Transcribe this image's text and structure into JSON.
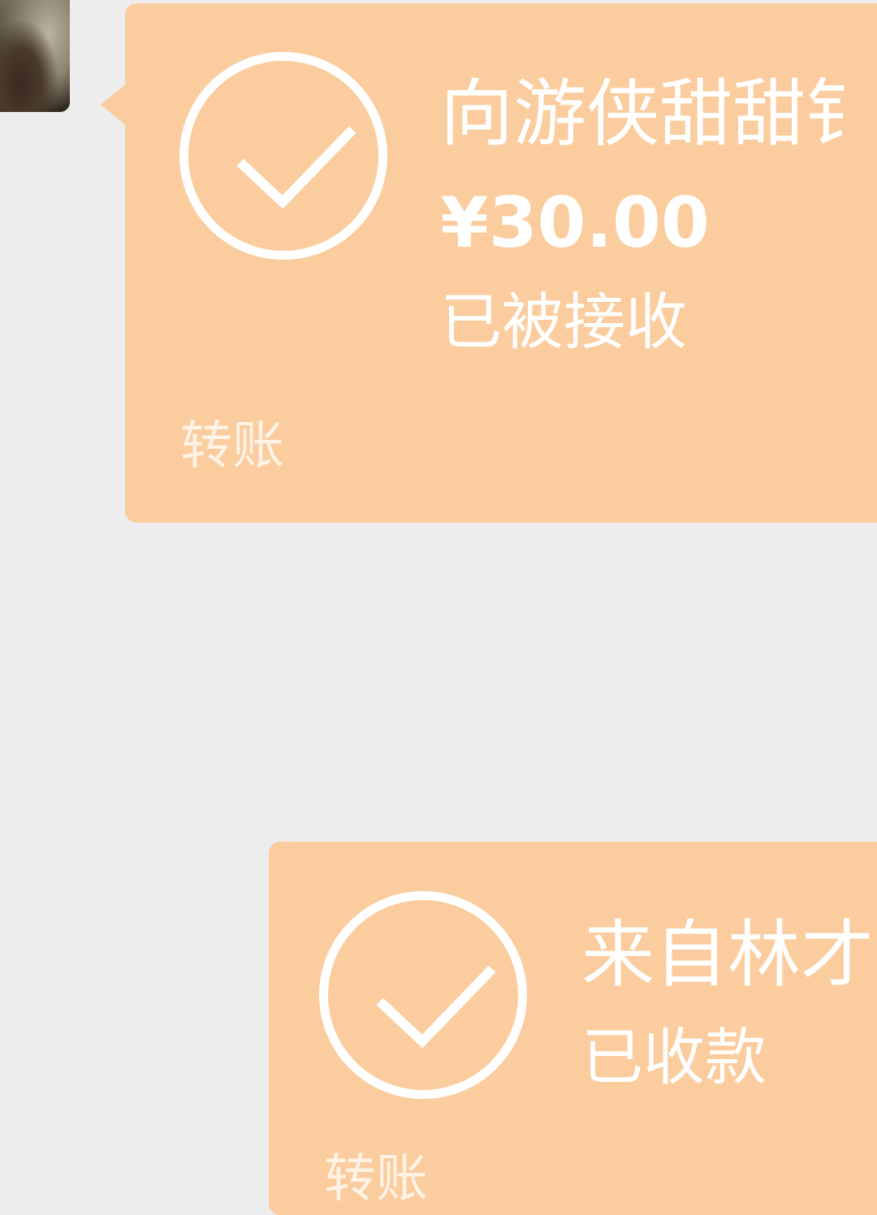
{
  "colors": {
    "background": "#ededed",
    "bubble": "#fbcc9d",
    "text": "#ffffff"
  },
  "messages": [
    {
      "type": "transfer",
      "icon": "check-circle-icon",
      "title": "向游侠甜甜钅",
      "amount": "¥30.00",
      "status": "已被接收",
      "footer": "转账"
    },
    {
      "type": "transfer",
      "icon": "check-circle-icon",
      "title": "来自林才",
      "status": "已收款",
      "footer": "转账"
    }
  ]
}
